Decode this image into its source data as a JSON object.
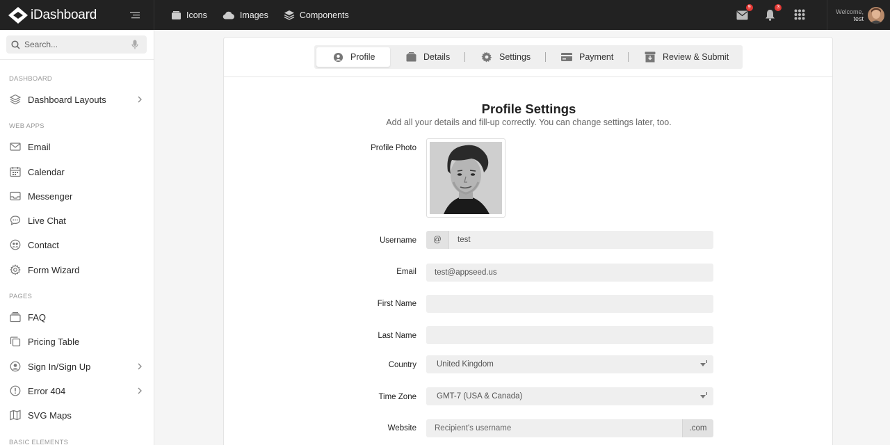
{
  "brand": {
    "name": "iDashboard"
  },
  "topnav": [
    {
      "label": "Icons",
      "icon": "icons-icon"
    },
    {
      "label": "Images",
      "icon": "cloud-icon"
    },
    {
      "label": "Components",
      "icon": "layers-icon"
    }
  ],
  "notifications": {
    "mail_count": "9",
    "bell_count": "3"
  },
  "user": {
    "welcome": "Welcome,",
    "name": "test"
  },
  "search": {
    "placeholder": "Search..."
  },
  "sidebar": {
    "sections": [
      {
        "title": "DASHBOARD"
      },
      {
        "title": "WEB APPS"
      },
      {
        "title": "PAGES"
      },
      {
        "title": "BASIC ELEMENTS"
      }
    ],
    "items": [
      {
        "label": "Dashboard Layouts",
        "icon": "layers-icon",
        "has_children": true
      },
      {
        "label": "Email",
        "icon": "mail-icon"
      },
      {
        "label": "Calendar",
        "icon": "calendar-icon"
      },
      {
        "label": "Messenger",
        "icon": "inbox-icon"
      },
      {
        "label": "Live Chat",
        "icon": "chat-icon"
      },
      {
        "label": "Contact",
        "icon": "contacts-icon"
      },
      {
        "label": "Form Wizard",
        "icon": "gear-icon"
      },
      {
        "label": "FAQ",
        "icon": "folder-icon"
      },
      {
        "label": "Pricing Table",
        "icon": "copy-icon"
      },
      {
        "label": "Sign In/Sign Up",
        "icon": "user-circle-icon",
        "has_children": true
      },
      {
        "label": "Error 404",
        "icon": "alert-circle-icon",
        "has_children": true
      },
      {
        "label": "SVG Maps",
        "icon": "map-icon"
      }
    ]
  },
  "wizard": {
    "tabs": [
      {
        "label": "Profile",
        "icon": "user-circle-icon",
        "active": true
      },
      {
        "label": "Details",
        "icon": "database-icon"
      },
      {
        "label": "Settings",
        "icon": "gear-icon"
      },
      {
        "label": "Payment",
        "icon": "credit-card-icon"
      },
      {
        "label": "Review & Submit",
        "icon": "archive-icon"
      }
    ]
  },
  "form": {
    "title": "Profile Settings",
    "subtitle": "Add all your details and fill-up correctly. You can change settings later, too.",
    "photo_label": "Profile Photo",
    "username_label": "Username",
    "username_prefix": "@",
    "username_value": "test",
    "email_label": "Email",
    "email_value": "test@appseed.us",
    "firstname_label": "First Name",
    "firstname_value": "",
    "lastname_label": "Last Name",
    "lastname_value": "",
    "country_label": "Country",
    "country_value": "United Kingdom",
    "timezone_label": "Time Zone",
    "timezone_value": "GMT-7 (USA & Canada)",
    "website_label": "Website",
    "website_placeholder": "Recipient's username",
    "website_suffix": ".com"
  }
}
